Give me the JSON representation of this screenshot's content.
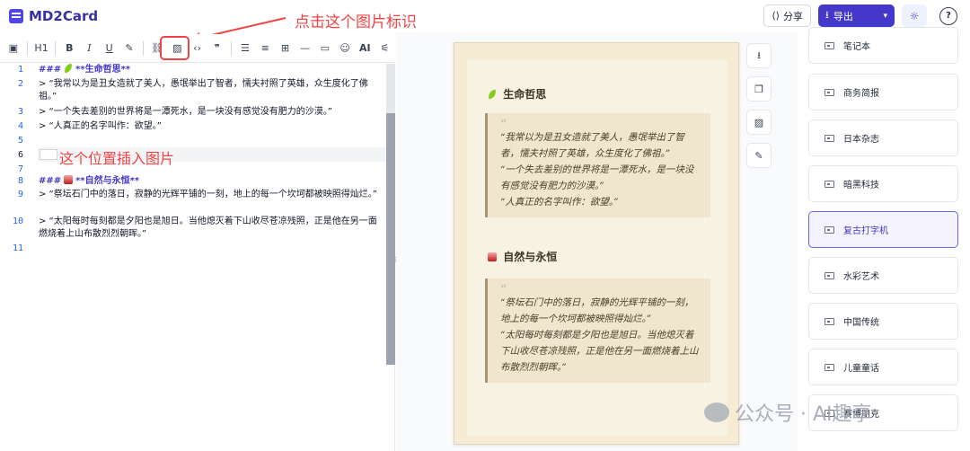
{
  "app": {
    "title": "MD2Card"
  },
  "header": {
    "share_label": "分享",
    "export_label": "导出"
  },
  "annotations": {
    "click_hint": "点击这个图片标识",
    "insert_hint": "这个位置插入图片",
    "color": "#ef4444"
  },
  "toolbar": {
    "items": [
      "sidebar-toggle",
      "heading",
      "bold",
      "italic",
      "underline",
      "strikethrough",
      "link",
      "image",
      "code",
      "quote",
      "bullet-list",
      "ordered-list",
      "table",
      "horizontal-rule",
      "code-block",
      "emoji",
      "ai",
      "settings"
    ],
    "labels": {
      "heading": "H1",
      "bold": "B",
      "italic": "I",
      "underline": "U",
      "ai": "AI"
    }
  },
  "editor": {
    "lines": [
      {
        "n": "1",
        "text": "**生命哲思**"
      },
      {
        "n": "2",
        "text": "> “我常以为是丑女造就了美人，愚氓举出了智者，懦夫衬照了英雄，众生度化了佛祖。”"
      },
      {
        "n": "3",
        "text": "> “一个失去差别的世界将是一潭死水，是一块没有感觉没有肥力的沙漠。”"
      },
      {
        "n": "4",
        "text": "> “人真正的名字叫作：欲望。”"
      },
      {
        "n": "5",
        "text": ""
      },
      {
        "n": "6",
        "text": ""
      },
      {
        "n": "7",
        "text": ""
      },
      {
        "n": "8",
        "text": "**自然与永恒**"
      },
      {
        "n": "9",
        "text": "> “祭坛石门中的落日，寂静的光辉平铺的一刻，地上的每一个坎坷都被映照得灿烂。”"
      },
      {
        "n": "10",
        "text": "> “太阳每时每刻都是夕阳也是旭日。当他熄灭着下山收尽苍凉残照，正是他在另一面燃烧着上山布散烈烈朝晖。”"
      },
      {
        "n": "11",
        "text": ""
      }
    ],
    "heading_prefix": "###"
  },
  "preview": {
    "sections": [
      {
        "title": "生命哲思",
        "quote": [
          "“我常以为是丑女造就了美人，愚氓举出了智者，懦夫衬照了英雄，众生度化了佛祖。”",
          "“一个失去差别的世界将是一潭死水，是一块没有感觉没有肥力的沙漠。”",
          "“人真正的名字叫作：欲望。”"
        ]
      },
      {
        "title": "自然与永恒",
        "quote": [
          "“祭坛石门中的落日，寂静的光辉平铺的一刻，地上的每一个坎坷都被映照得灿烂。”",
          "“太阳每时每刻都是夕阳也是旭日。当他熄灭着下山收尽苍凉残照，正是他在另一面燃烧着上山布散烈烈朝晖。”"
        ]
      }
    ]
  },
  "templates": {
    "items": [
      "笔记本",
      "商务简报",
      "日本杂志",
      "暗黑科技",
      "复古打字机",
      "水彩艺术",
      "中国传统",
      "儿童童话",
      "赛博朋克"
    ],
    "active_index": 4
  },
  "watermark": {
    "text": "公众号 · AI趣享"
  }
}
